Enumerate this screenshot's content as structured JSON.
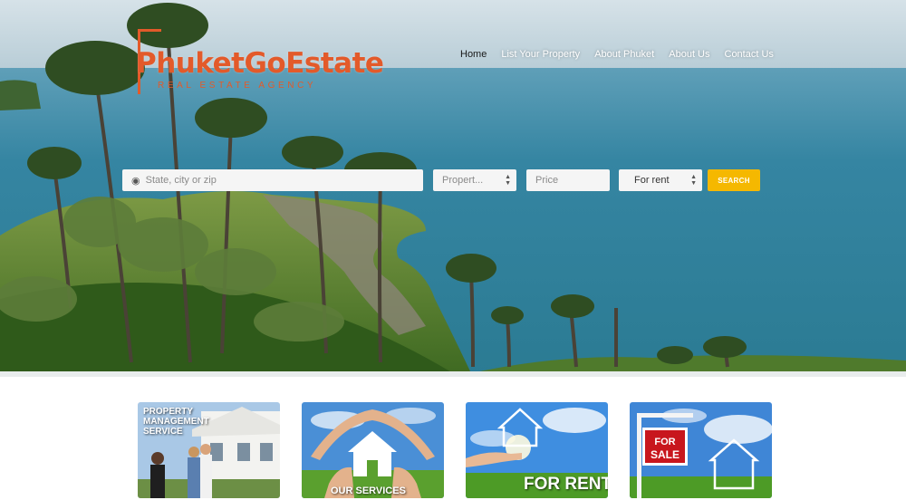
{
  "brand": {
    "name": "PhuketGoEstate",
    "tagline": "REAL ESTATE AGENCY",
    "color": "#e35a2a"
  },
  "nav": {
    "items": [
      {
        "label": "Home",
        "active": true
      },
      {
        "label": "List Your Property"
      },
      {
        "label": "About Phuket"
      },
      {
        "label": "About Us"
      },
      {
        "label": "Contact Us"
      }
    ]
  },
  "search": {
    "location_placeholder": "State, city or zip",
    "location_icon": "map-pin-icon",
    "property_type": "Propert...",
    "price_placeholder": "Price",
    "listing_type": "For rent",
    "button_label": "SEARCH",
    "button_color": "#f5b800"
  },
  "services": [
    {
      "label": "PROPERTY MANAGEMENT SERVICE"
    },
    {
      "label": "OUR SERVICES"
    },
    {
      "label": "FOR RENT"
    },
    {
      "sign_text": "FOR SALE"
    }
  ]
}
